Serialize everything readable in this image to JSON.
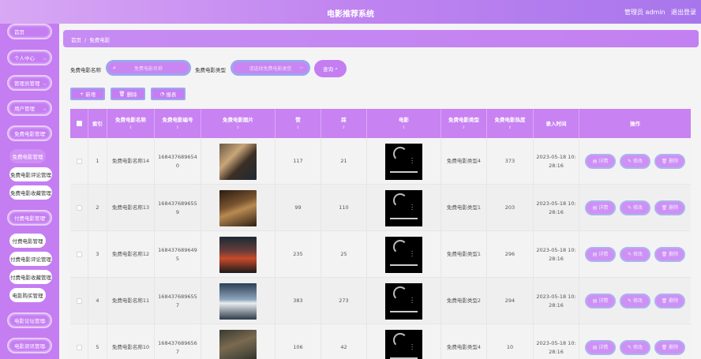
{
  "header": {
    "title": "电影推荐系统",
    "user": "管理员 admin",
    "logout": "退出登录"
  },
  "sidebar": {
    "items": [
      {
        "label": "首页"
      },
      {
        "label": "个人中心"
      },
      {
        "label": "管理员管理"
      },
      {
        "label": "用户管理"
      },
      {
        "label": "免费电影管理"
      }
    ],
    "free_sub": [
      "免费电影管理",
      "免费电影评论管理",
      "免费电影收藏管理"
    ],
    "paid_label": "付费电影管理",
    "paid_sub": [
      "付费电影管理",
      "付费电影评论管理",
      "付费电影收藏管理",
      "电影购买管理"
    ],
    "more": [
      "电影论坛管理",
      "电影资讯管理"
    ]
  },
  "breadcrumb": {
    "home": "首页",
    "sep": "/",
    "current": "免费电影"
  },
  "search": {
    "name_label": "免费电影名称",
    "name_placeholder": "免费电影名称",
    "type_label": "免费电影类型",
    "type_placeholder": "请选择免费电影类型",
    "query_label": "查询"
  },
  "toolbar": {
    "add": "新增",
    "delete": "删除",
    "report": "报表"
  },
  "colors": {
    "accent": "#c57df2",
    "border": "#9ba6f0"
  },
  "icons": {
    "search": "search-icon",
    "add": "plus-icon",
    "delete": "trash-icon",
    "report": "pie-chart-icon",
    "detail": "detail-icon",
    "edit": "edit-icon"
  },
  "table": {
    "headers": [
      "索引",
      "免费电影名称",
      "免费电影编号",
      "免费电影图片",
      "赞",
      "踩",
      "电影",
      "免费电影类型",
      "免费电影热度",
      "录入时间",
      "操作"
    ],
    "sortable": [
      false,
      true,
      true,
      true,
      true,
      true,
      true,
      true,
      true,
      false,
      false
    ],
    "actions": {
      "detail": "详情",
      "edit": "修改",
      "delete": "删除"
    },
    "rows": [
      {
        "index": "1",
        "name": "免费电影名称14",
        "code": [
          "168437689654",
          "0"
        ],
        "likes": "117",
        "dislikes": "21",
        "type": "免费电影类型4",
        "heat": "373",
        "time": [
          "2023-05-18 10:",
          "28:16"
        ]
      },
      {
        "index": "2",
        "name": "免费电影名称13",
        "code": [
          "168437689655",
          "9"
        ],
        "likes": "99",
        "dislikes": "110",
        "type": "免费电影类型1",
        "heat": "203",
        "time": [
          "2023-05-18 10:",
          "28:16"
        ]
      },
      {
        "index": "3",
        "name": "免费电影名称12",
        "code": [
          "168437689649",
          "5"
        ],
        "likes": "235",
        "dislikes": "25",
        "type": "免费电影类型1",
        "heat": "296",
        "time": [
          "2023-05-18 10:",
          "28:16"
        ]
      },
      {
        "index": "4",
        "name": "免费电影名称11",
        "code": [
          "168437689655",
          "7"
        ],
        "likes": "383",
        "dislikes": "273",
        "type": "免费电影类型2",
        "heat": "294",
        "time": [
          "2023-05-18 10:",
          "28:16"
        ]
      },
      {
        "index": "5",
        "name": "免费电影名称10",
        "code": [
          "168437689656",
          "7"
        ],
        "likes": "106",
        "dislikes": "42",
        "type": "免费电影类型4",
        "heat": "10",
        "time": [
          "2023-05-18 10:",
          "28:16"
        ]
      }
    ]
  }
}
